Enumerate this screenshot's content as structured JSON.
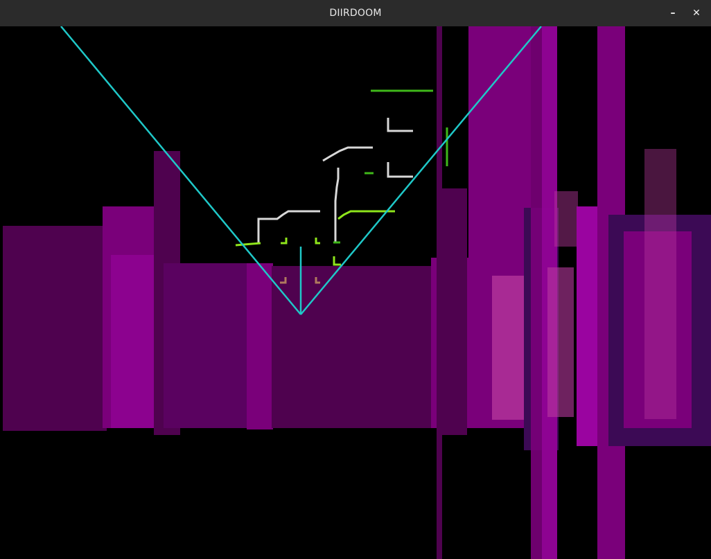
{
  "window": {
    "title": "DIIRDOOM",
    "minimize_icon": "minimize-icon",
    "minimize_glyph": "–",
    "close_icon": "close-icon",
    "close_glyph": "✕"
  },
  "scene": {
    "wall_colors": {
      "dark": "#4f024f",
      "mid": "#7a007a",
      "bright": "#9a04a0",
      "pale": "#b8389e",
      "indigo": "#3c0a55"
    },
    "automap_colors": {
      "fov_lines": "#1fc8c8",
      "wall_white": "#d8d8d8",
      "wall_green": "#3fb81a",
      "wall_lime": "#8ee51b",
      "marker_tan": "#b07a5e"
    }
  }
}
